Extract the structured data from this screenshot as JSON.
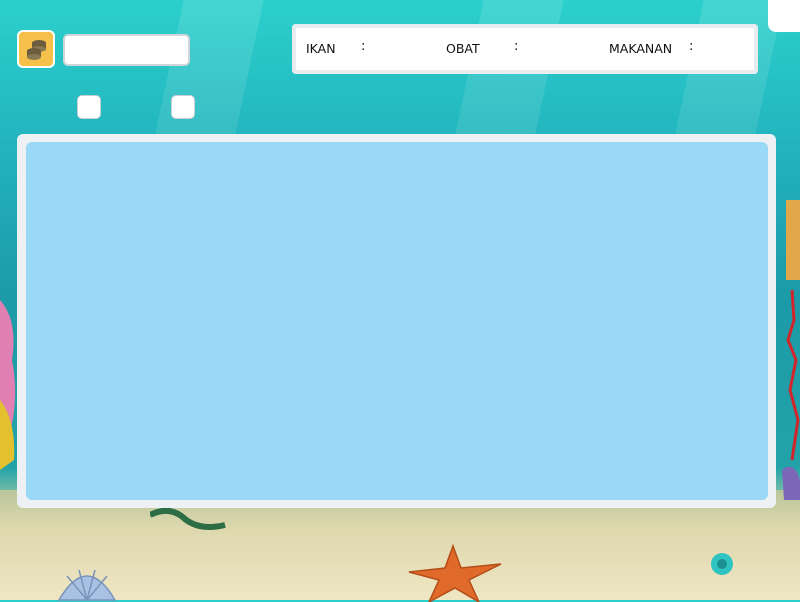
{
  "stats": {
    "ikan_label": "IKAN",
    "obat_label": "OBAT",
    "makanan_label": "MAKANAN",
    "separator": ":"
  },
  "icons": {
    "coin": "coin-stack-icon",
    "starfish": "starfish-icon",
    "shell": "seashell-icon"
  },
  "colors": {
    "ocean_top": "#2bd0cc",
    "coin_button": "#f6c14b",
    "aquarium_water": "#9ad8f8",
    "panel": "#ffffff"
  }
}
